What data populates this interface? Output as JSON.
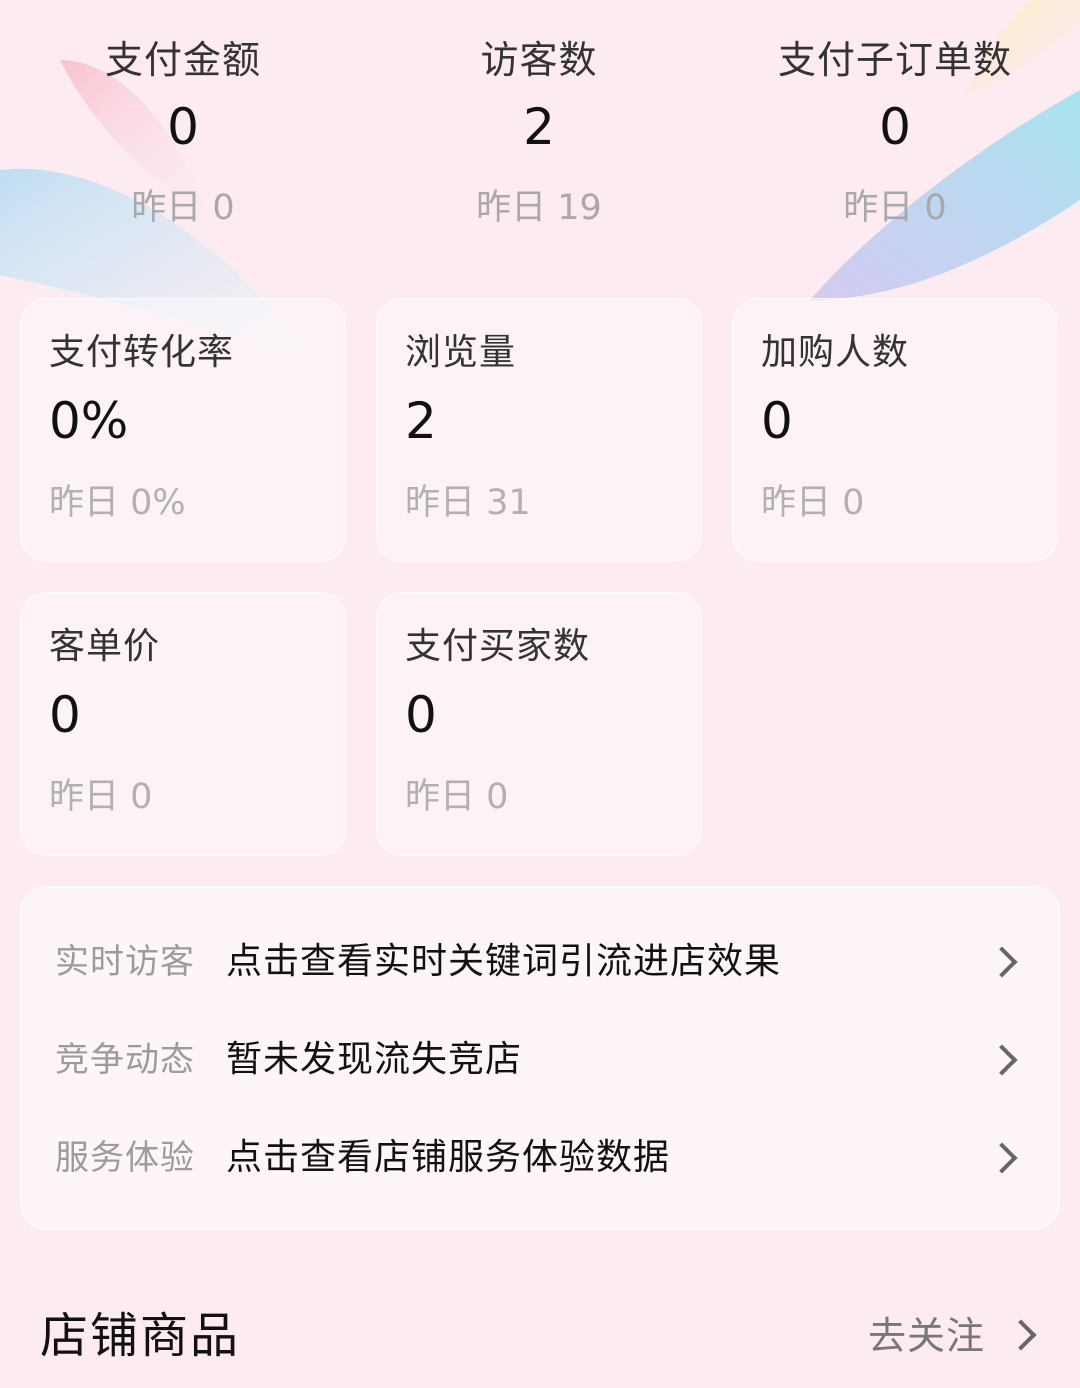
{
  "top_stats": [
    {
      "label": "支付金额",
      "value": "0",
      "yesterday": "昨日 0"
    },
    {
      "label": "访客数",
      "value": "2",
      "yesterday": "昨日 19"
    },
    {
      "label": "支付子订单数",
      "value": "0",
      "yesterday": "昨日 0"
    }
  ],
  "cards": [
    {
      "label": "支付转化率",
      "value": "0%",
      "yesterday": "昨日 0%"
    },
    {
      "label": "浏览量",
      "value": "2",
      "yesterday": "昨日 31"
    },
    {
      "label": "加购人数",
      "value": "0",
      "yesterday": "昨日 0"
    },
    {
      "label": "客单价",
      "value": "0",
      "yesterday": "昨日 0"
    },
    {
      "label": "支付买家数",
      "value": "0",
      "yesterday": "昨日 0"
    }
  ],
  "insights": [
    {
      "label": "实时访客",
      "text": "点击查看实时关键词引流进店效果"
    },
    {
      "label": "竞争动态",
      "text": "暂未发现流失竞店"
    },
    {
      "label": "服务体验",
      "text": "点击查看店铺服务体验数据"
    }
  ],
  "store_products": {
    "title": "店铺商品",
    "action": "去关注"
  },
  "icons": {
    "chevron": "chevron-right-icon"
  },
  "colors": {
    "background": "#fcebf1",
    "muted_text": "#a9a9ad"
  }
}
